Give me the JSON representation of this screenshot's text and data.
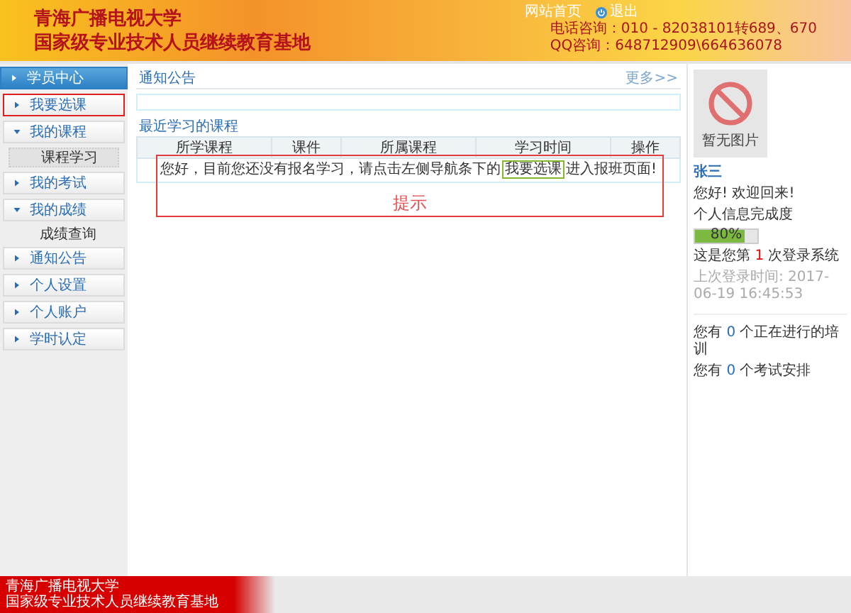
{
  "header": {
    "title_line_1": "青海广播电视大学",
    "title_line_2": "国家级专业技术人员继续教育基地",
    "links": [
      "网站首页",
      "退出"
    ],
    "phone": "电话咨询：010 - 82038101转689、670",
    "qq": "QQ咨询：648712909\\664636078"
  },
  "sidebar": {
    "items": [
      {
        "label": "学员中心",
        "kind": "header"
      },
      {
        "label": "我要选课",
        "kind": "menu",
        "expanded": false,
        "highlighted": true
      },
      {
        "label": "我的课程",
        "kind": "menu",
        "expanded": true,
        "highlighted": false,
        "children": [
          {
            "label": "课程学习",
            "selected": true
          }
        ]
      },
      {
        "label": "我的考试",
        "kind": "menu",
        "expanded": false,
        "highlighted": false
      },
      {
        "label": "我的成绩",
        "kind": "menu",
        "expanded": true,
        "highlighted": false,
        "children": [
          {
            "label": "成绩查询",
            "selected": false
          }
        ]
      },
      {
        "label": "通知公告",
        "kind": "menu",
        "expanded": false,
        "highlighted": false
      },
      {
        "label": "个人设置",
        "kind": "menu",
        "expanded": false,
        "highlighted": false
      },
      {
        "label": "个人账户",
        "kind": "menu",
        "expanded": false,
        "highlighted": false
      },
      {
        "label": "学时认定",
        "kind": "menu",
        "expanded": false,
        "highlighted": false
      }
    ]
  },
  "notice": {
    "title": "通知公告",
    "more": "更多>>"
  },
  "recent": {
    "title": "最近学习的课程",
    "columns": [
      "所学课程",
      "课件",
      "所属课程",
      "学习时间",
      "操作"
    ],
    "message_before": "您好，目前您还没有报名学习，请点击左侧导航条下的",
    "message_link": "我要选课",
    "message_after": "进入报班页面!",
    "annotation": {
      "label": "提示"
    }
  },
  "profile": {
    "photo_text": "暂无图片",
    "name": "张三",
    "greeting": "您好! 欢迎回来!",
    "completion_label": "个人信息完成度",
    "completion": {
      "level": 0.8,
      "reading": "80%"
    },
    "login_prefix": "这是您第 ",
    "login_count": "1",
    "login_suffix": " 次登录系统",
    "last_login": "上次登录时间: 2017-06-19 16:45:53",
    "stats": [
      {
        "prefix": "您有 ",
        "count": "0",
        "suffix": " 个正在进行的培训"
      },
      {
        "prefix": "您有 ",
        "count": "0",
        "suffix": " 个考试安排"
      }
    ]
  },
  "footer": {
    "line_1": "青海广播电视大学",
    "line_2": "国家级专业技术人员继续教育基地"
  }
}
